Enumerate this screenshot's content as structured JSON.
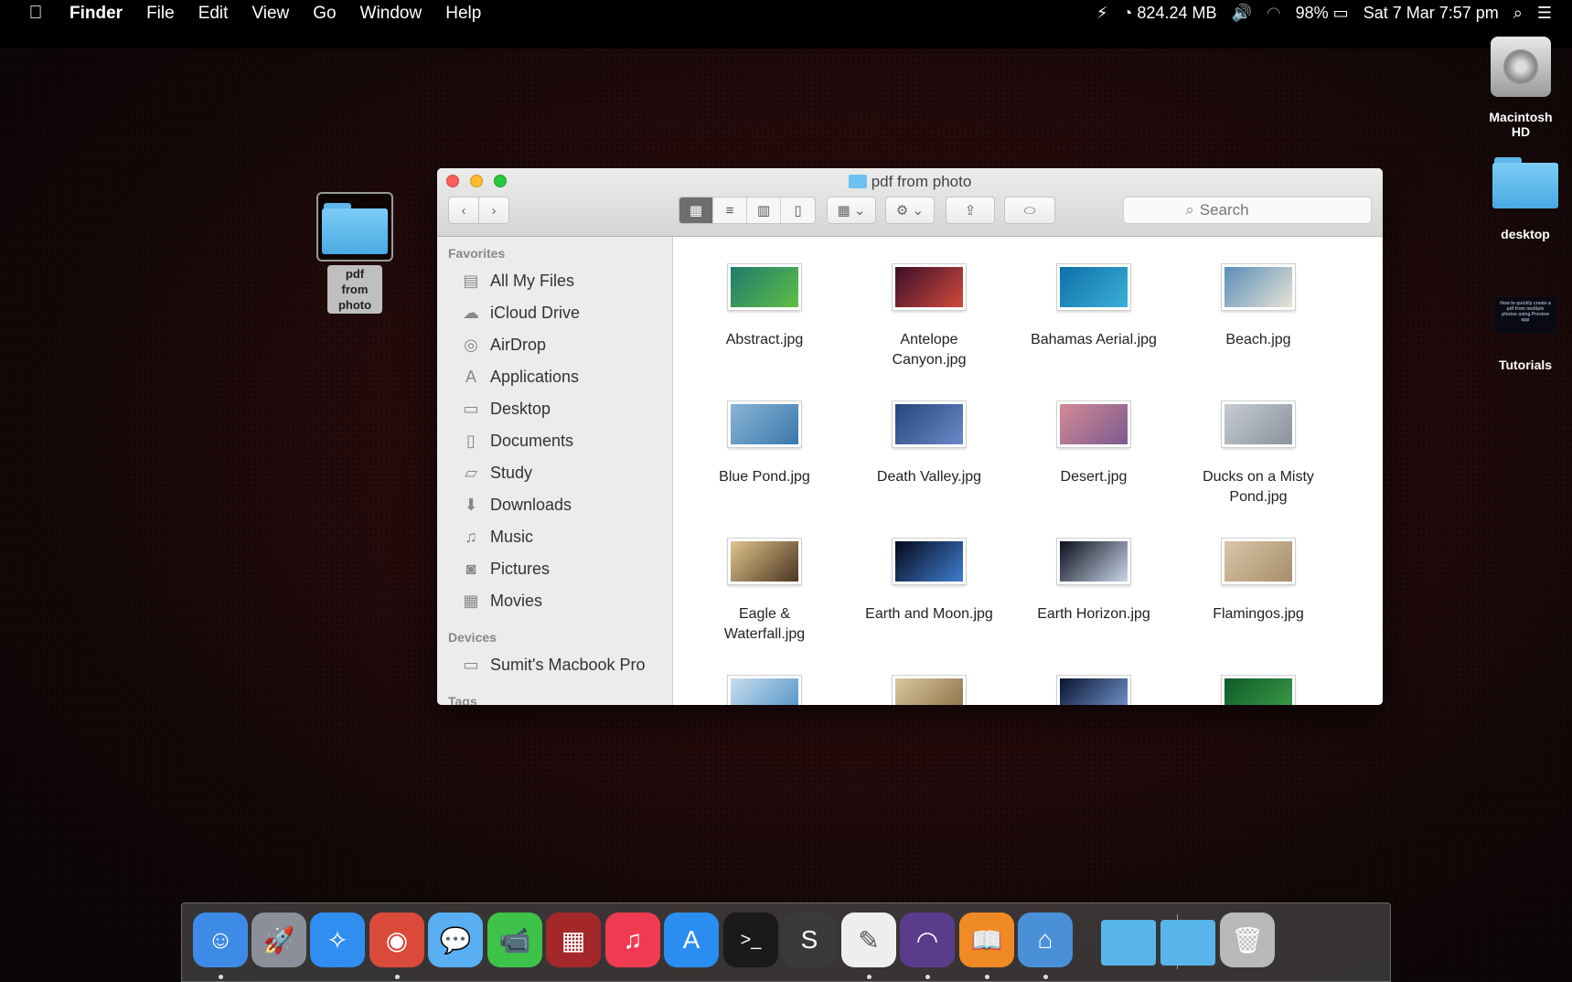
{
  "menubar": {
    "app_name": "Finder",
    "menus": [
      "File",
      "Edit",
      "View",
      "Go",
      "Window",
      "Help"
    ],
    "memory": "824.24 MB",
    "battery": "98%",
    "datetime": "Sat 7 Mar  7:57 pm"
  },
  "desktop": {
    "selected_folder": "pdf from photo",
    "right_icons": [
      {
        "label": "Macintosh HD",
        "icon": "hard-drive-icon"
      },
      {
        "label": "desktop",
        "icon": "folder-icon"
      },
      {
        "label": "Tutorials",
        "icon": "image-thumbnail-icon"
      }
    ],
    "tutorial_thumb_text": "How to quickly create a pdf from multiple photos using Preview app"
  },
  "window": {
    "title": "pdf from photo",
    "search_placeholder": "Search",
    "sidebar": {
      "favorites_heading": "Favorites",
      "favorites": [
        {
          "label": "All My Files",
          "icon": "all-files-icon"
        },
        {
          "label": "iCloud Drive",
          "icon": "cloud-icon"
        },
        {
          "label": "AirDrop",
          "icon": "airdrop-icon"
        },
        {
          "label": "Applications",
          "icon": "applications-icon"
        },
        {
          "label": "Desktop",
          "icon": "desktop-icon"
        },
        {
          "label": "Documents",
          "icon": "documents-icon"
        },
        {
          "label": "Study",
          "icon": "folder-icon"
        },
        {
          "label": "Downloads",
          "icon": "downloads-icon"
        },
        {
          "label": "Music",
          "icon": "music-icon"
        },
        {
          "label": "Pictures",
          "icon": "camera-icon"
        },
        {
          "label": "Movies",
          "icon": "film-icon"
        }
      ],
      "devices_heading": "Devices",
      "devices": [
        {
          "label": "Sumit's Macbook Pro",
          "icon": "laptop-icon"
        }
      ],
      "tags_heading": "Tags"
    },
    "files": [
      {
        "name": "Abstract.jpg",
        "colors": [
          "#1f7a6e",
          "#5fbf45"
        ]
      },
      {
        "name": "Antelope Canyon.jpg",
        "colors": [
          "#3a0f28",
          "#d24a3a"
        ]
      },
      {
        "name": "Bahamas Aerial.jpg",
        "colors": [
          "#0e6fa8",
          "#3bb0d8"
        ]
      },
      {
        "name": "Beach.jpg",
        "colors": [
          "#5a8fb8",
          "#e8e2d4"
        ]
      },
      {
        "name": "Blue Pond.jpg",
        "colors": [
          "#8ab4d6",
          "#3978ab"
        ]
      },
      {
        "name": "Death Valley.jpg",
        "colors": [
          "#27457e",
          "#6a8bc8"
        ]
      },
      {
        "name": "Desert.jpg",
        "colors": [
          "#d48a96",
          "#7a5a8e"
        ]
      },
      {
        "name": "Ducks on a Misty Pond.jpg",
        "colors": [
          "#c7ccd2",
          "#8a929c"
        ]
      },
      {
        "name": "Eagle & Waterfall.jpg",
        "colors": [
          "#e0c48c",
          "#4a3520"
        ]
      },
      {
        "name": "Earth and Moon.jpg",
        "colors": [
          "#05091a",
          "#3d7fd0"
        ]
      },
      {
        "name": "Earth Horizon.jpg",
        "colors": [
          "#0b0f1e",
          "#c9d6e6"
        ]
      },
      {
        "name": "Flamingos.jpg",
        "colors": [
          "#d8c6a8",
          "#a88e6a"
        ]
      },
      {
        "name": "",
        "colors": [
          "#c8dcee",
          "#4a8fc4"
        ]
      },
      {
        "name": "",
        "colors": [
          "#d8c8a2",
          "#8a6a3e"
        ]
      },
      {
        "name": "",
        "colors": [
          "#0a1430",
          "#7aa0dd"
        ]
      },
      {
        "name": "",
        "colors": [
          "#0e5a28",
          "#3fa04a"
        ]
      }
    ]
  },
  "dock": {
    "apps": [
      {
        "name": "finder-icon",
        "bg": "#3d8be6",
        "glyph": "☺",
        "running": true
      },
      {
        "name": "launchpad-icon",
        "bg": "#8a8f99",
        "glyph": "🚀",
        "running": false
      },
      {
        "name": "safari-icon",
        "bg": "#2f8ef0",
        "glyph": "✧",
        "running": false
      },
      {
        "name": "chrome-icon",
        "bg": "#d94a3a",
        "glyph": "◉",
        "running": true
      },
      {
        "name": "messages-icon",
        "bg": "#5aaef2",
        "glyph": "💬",
        "running": false
      },
      {
        "name": "facetime-icon",
        "bg": "#3ec24a",
        "glyph": "📹",
        "running": false
      },
      {
        "name": "photo-booth-icon",
        "bg": "#a4282a",
        "glyph": "▦",
        "running": false
      },
      {
        "name": "itunes-icon",
        "bg": "#f03a52",
        "glyph": "♫",
        "running": false
      },
      {
        "name": "app-store-icon",
        "bg": "#2a8ef0",
        "glyph": "A",
        "running": false
      },
      {
        "name": "terminal-icon",
        "bg": "#1a1a1a",
        "glyph": ">_",
        "running": false
      },
      {
        "name": "sublime-text-icon",
        "bg": "#3a3a3a",
        "glyph": "S",
        "running": false
      },
      {
        "name": "textedit-icon",
        "bg": "#eeeeee",
        "glyph": "✎",
        "running": true
      },
      {
        "name": "bittorrent-icon",
        "bg": "#5a3c8c",
        "glyph": "◠",
        "running": true
      },
      {
        "name": "ibooks-icon",
        "bg": "#f08a24",
        "glyph": "📖",
        "running": true
      },
      {
        "name": "keynote-icon",
        "bg": "#4a90d8",
        "glyph": "⌂",
        "running": true
      },
      {
        "name": "applications-folder-icon",
        "bg": "#58b5ec",
        "glyph": "",
        "running": false
      },
      {
        "name": "documents-folder-icon",
        "bg": "#58b5ec",
        "glyph": "",
        "running": false
      },
      {
        "name": "trash-icon",
        "bg": "#b9b9b9",
        "glyph": "🗑",
        "running": false
      }
    ]
  }
}
